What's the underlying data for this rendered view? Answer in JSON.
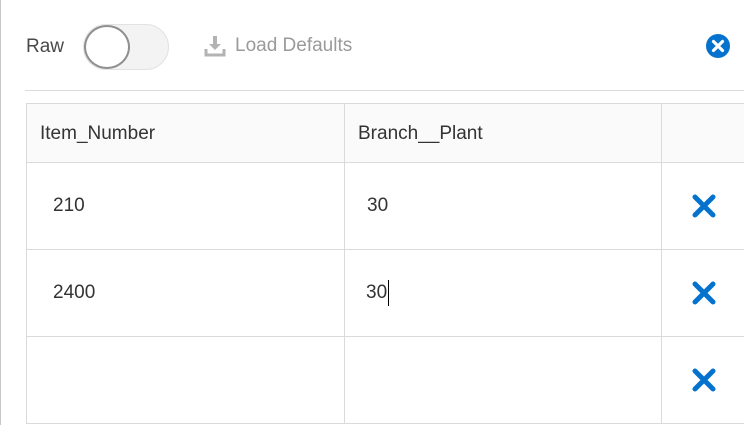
{
  "toolbar": {
    "raw_label": "Raw",
    "raw_toggle_on": false,
    "load_defaults_label": "Load Defaults",
    "load_defaults_icon": "download-icon",
    "close_icon": "close-circle-icon",
    "accent_color": "#0572ce"
  },
  "grid": {
    "columns": [
      "Item_Number",
      "Branch__Plant",
      ""
    ],
    "rows": [
      {
        "item_number": "210",
        "branch_plant": "30"
      },
      {
        "item_number": "2400",
        "branch_plant": "30"
      },
      {
        "item_number": "",
        "branch_plant": ""
      }
    ],
    "delete_icon": "x-icon"
  }
}
